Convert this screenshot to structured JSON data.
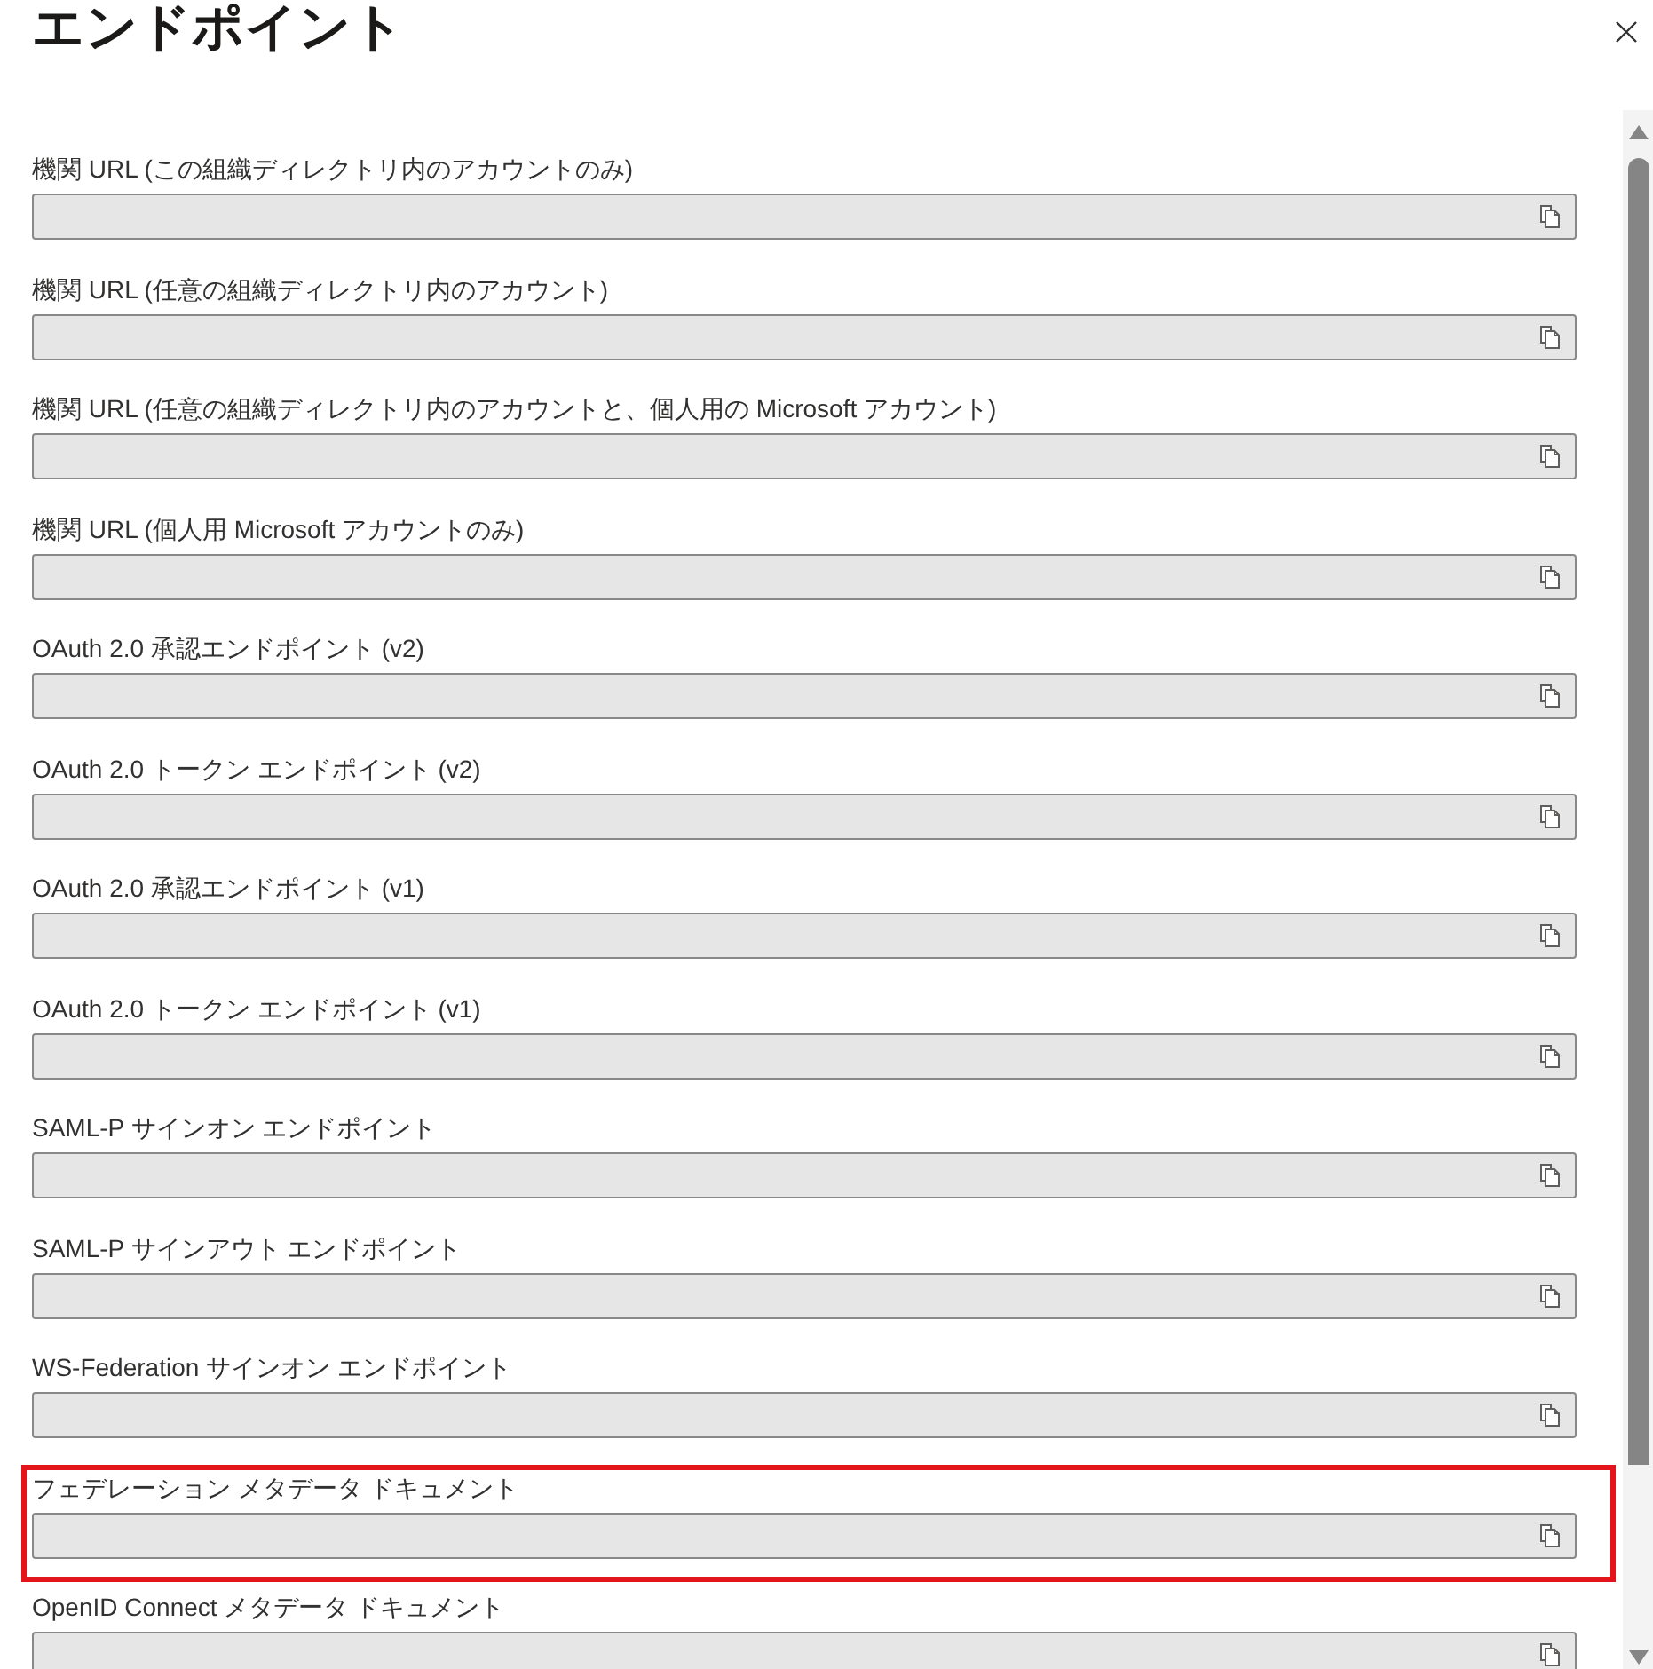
{
  "panel": {
    "title": "エンドポイント"
  },
  "endpoints": [
    {
      "label": "機関 URL (この組織ディレクトリ内のアカウントのみ)",
      "highlighted": false
    },
    {
      "label": "機関 URL (任意の組織ディレクトリ内のアカウント)",
      "highlighted": false
    },
    {
      "label": "機関 URL (任意の組織ディレクトリ内のアカウントと、個人用の Microsoft アカウント)",
      "highlighted": false
    },
    {
      "label": "機関 URL (個人用 Microsoft アカウントのみ)",
      "highlighted": false
    },
    {
      "label": "OAuth 2.0 承認エンドポイント (v2)",
      "highlighted": false
    },
    {
      "label": "OAuth 2.0 トークン エンドポイント (v2)",
      "highlighted": false
    },
    {
      "label": "OAuth 2.0 承認エンドポイント (v1)",
      "highlighted": false
    },
    {
      "label": "OAuth 2.0 トークン エンドポイント (v1)",
      "highlighted": false
    },
    {
      "label": "SAML-P サインオン エンドポイント",
      "highlighted": false
    },
    {
      "label": "SAML-P サインアウト エンドポイント",
      "highlighted": false
    },
    {
      "label": "WS-Federation サインオン エンドポイント",
      "highlighted": false
    },
    {
      "label": "フェデレーション メタデータ ドキュメント",
      "highlighted": true
    },
    {
      "label": "OpenID Connect メタデータ ドキュメント",
      "highlighted": false
    }
  ]
}
